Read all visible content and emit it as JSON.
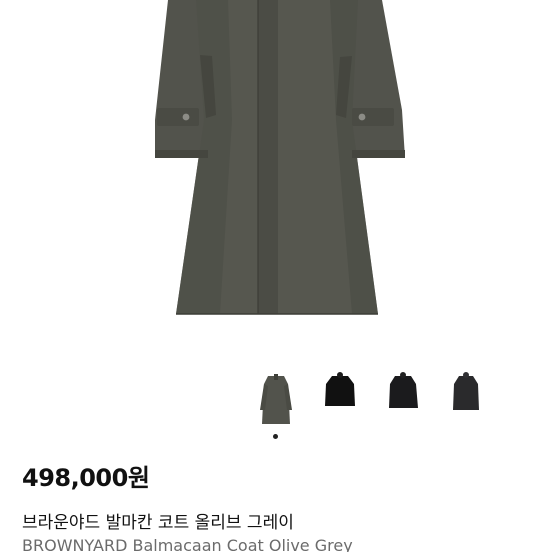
{
  "product": {
    "price": "498,000원",
    "title_ko": "브라운야드 발마칸 코트 올리브 그레이",
    "title_en": "BROWNYARD Balmacaan Coat Olive Grey"
  },
  "gallery": {
    "selected_index": 0,
    "thumbnails": [
      {
        "color_name": "olive-grey",
        "color": "#4f5049"
      },
      {
        "color_name": "black",
        "color": "#111111"
      },
      {
        "color_name": "black-2",
        "color": "#1b1b1d"
      },
      {
        "color_name": "charcoal",
        "color": "#2a2a2c"
      }
    ]
  },
  "colors": {
    "coat_main": "#55564f",
    "coat_dark": "#45463f",
    "coat_shadow": "#3c3d37",
    "tab_button": "#8c8c86",
    "dot_active": "#222222"
  }
}
